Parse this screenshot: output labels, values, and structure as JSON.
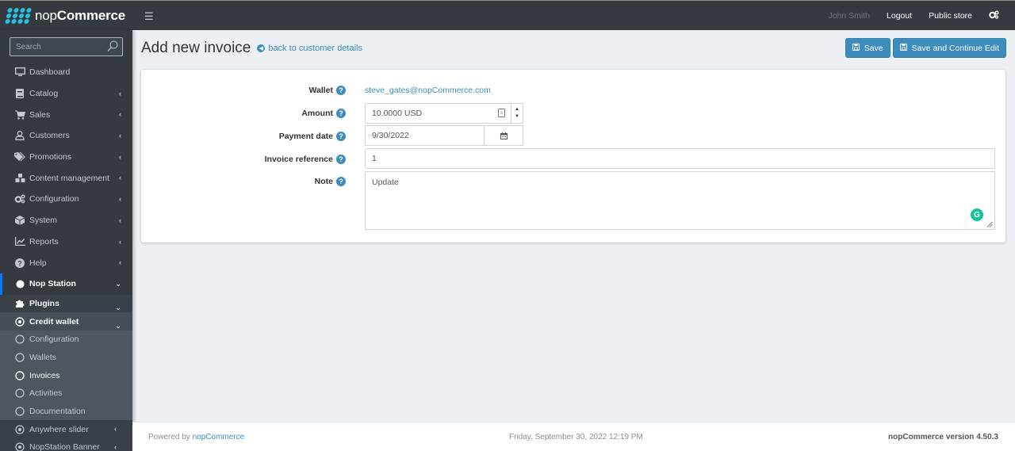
{
  "brand": {
    "light": "nop",
    "bold": "Commerce"
  },
  "topbar": {
    "menu_icon": "hamburger-icon",
    "user": "John Smith",
    "logout": "Logout",
    "public_store": "Public store",
    "settings_icon": "gears-icon"
  },
  "sidebar": {
    "search_placeholder": "Search",
    "items": [
      {
        "label": "Dashboard",
        "icon": "desktop-icon",
        "chevron": false
      },
      {
        "label": "Catalog",
        "icon": "book-icon",
        "chevron": true
      },
      {
        "label": "Sales",
        "icon": "cart-icon",
        "chevron": true
      },
      {
        "label": "Customers",
        "icon": "user-icon",
        "chevron": true
      },
      {
        "label": "Promotions",
        "icon": "tags-icon",
        "chevron": true
      },
      {
        "label": "Content management",
        "icon": "cubes-icon",
        "chevron": true
      },
      {
        "label": "Configuration",
        "icon": "gears-icon",
        "chevron": true
      },
      {
        "label": "System",
        "icon": "cube-icon",
        "chevron": true
      },
      {
        "label": "Reports",
        "icon": "chart-icon",
        "chevron": true
      },
      {
        "label": "Help",
        "icon": "question-icon",
        "chevron": true
      },
      {
        "label": "Nop Station",
        "icon": "circle-icon",
        "chevron": "down",
        "active": true
      }
    ],
    "nop_station_children": [
      {
        "label": "Plugins",
        "icon": "puzzle-icon"
      },
      {
        "label": "Credit wallet",
        "icon": "dot-circle-icon"
      }
    ],
    "credit_wallet_children": [
      {
        "label": "Configuration",
        "icon": "circle-outline-icon"
      },
      {
        "label": "Wallets",
        "icon": "circle-outline-icon"
      },
      {
        "label": "Invoices",
        "icon": "circle-outline-icon",
        "active": true
      },
      {
        "label": "Activities",
        "icon": "circle-outline-icon"
      },
      {
        "label": "Documentation",
        "icon": "circle-outline-icon"
      }
    ],
    "plugin_siblings": [
      {
        "label": "Anywhere slider",
        "icon": "dot-circle-icon"
      },
      {
        "label": "NopStation Banner",
        "icon": "dot-circle-icon"
      }
    ]
  },
  "page": {
    "title": "Add new invoice",
    "back_link": "back to customer details",
    "save": "Save",
    "save_continue": "Save and Continue Edit"
  },
  "form": {
    "wallet_label": "Wallet",
    "wallet_value": "steve_gates@nopCommerce.com",
    "amount_label": "Amount",
    "amount_value": "10.0000 USD",
    "payment_date_label": "Payment date",
    "payment_date_value": "9/30/2022",
    "invoice_reference_label": "Invoice reference",
    "invoice_reference_value": "1",
    "note_label": "Note",
    "note_value": "Update"
  },
  "footer": {
    "powered_by": "Powered by ",
    "powered_link": "nopCommerce",
    "datetime": "Friday, September 30, 2022 12:19 PM",
    "version": "nopCommerce version 4.50.3"
  },
  "colors": {
    "accent": "#3c8dbc",
    "sidebar_bg": "#343a40",
    "active_indicator": "#007bff",
    "grammarly": "#15c39a"
  }
}
